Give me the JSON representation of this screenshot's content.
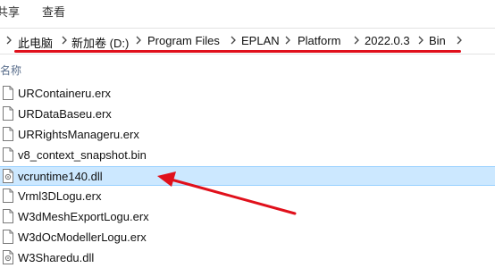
{
  "ribbon": {
    "tabs": [
      "共享",
      "查看"
    ]
  },
  "address": {
    "crumbs": [
      "此电脑",
      "新加卷 (D:)",
      "Program Files",
      "EPLAN",
      "Platform",
      "2022.0.3",
      "Bin"
    ]
  },
  "list": {
    "header": "名称",
    "files": [
      {
        "name": "URContaineru.erx",
        "icon": "blank-file-icon",
        "selected": false
      },
      {
        "name": "URDataBaseu.erx",
        "icon": "blank-file-icon",
        "selected": false
      },
      {
        "name": "URRightsManageru.erx",
        "icon": "blank-file-icon",
        "selected": false
      },
      {
        "name": "v8_context_snapshot.bin",
        "icon": "blank-file-icon",
        "selected": false
      },
      {
        "name": "vcruntime140.dll",
        "icon": "dll-file-icon",
        "selected": true
      },
      {
        "name": "Vrml3DLogu.erx",
        "icon": "blank-file-icon",
        "selected": false
      },
      {
        "name": "W3dMeshExportLogu.erx",
        "icon": "blank-file-icon",
        "selected": false
      },
      {
        "name": "W3dOcModellerLogu.erx",
        "icon": "blank-file-icon",
        "selected": false
      },
      {
        "name": "W3Sharedu.dll",
        "icon": "dll-file-icon",
        "selected": false
      }
    ]
  },
  "colors": {
    "annotation": "#e0101b",
    "selection": "#cce8ff"
  }
}
